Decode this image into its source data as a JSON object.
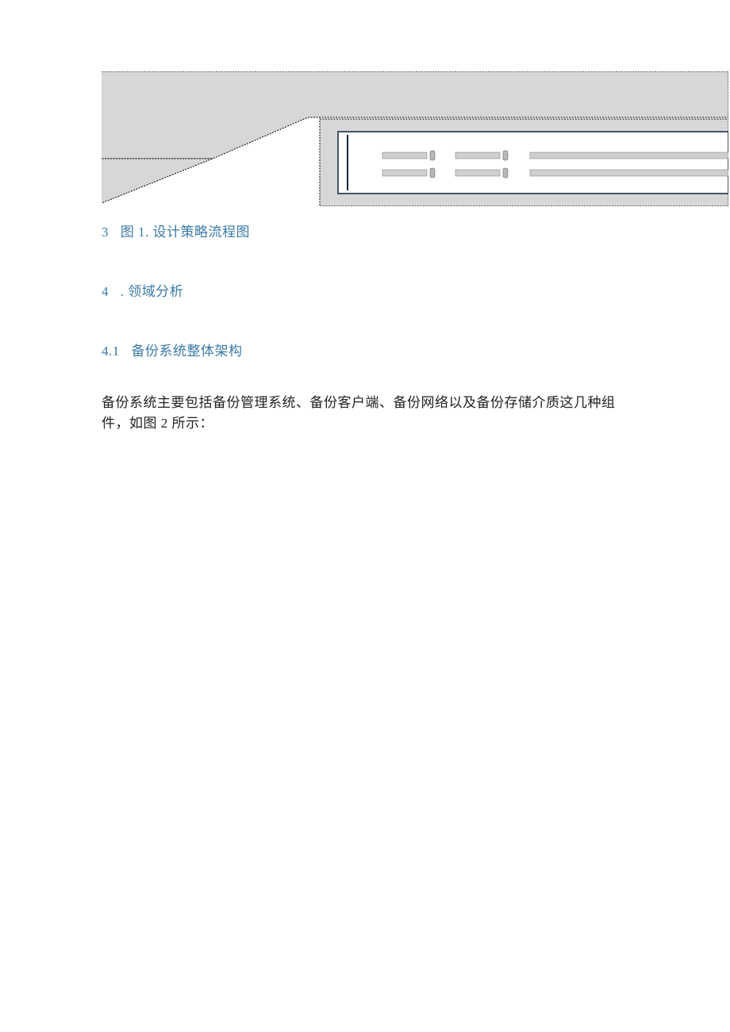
{
  "sections": {
    "caption": {
      "num": "3",
      "text": "图 1. 设计策略流程图"
    },
    "s4": {
      "num": "4",
      "text": ". 领域分析"
    },
    "s41": {
      "num": "4.1",
      "text": "备份系统整体架构"
    }
  },
  "paragraph": "备份系统主要包括备份管理系统、备份客户端、备份网络以及备份存储介质这几种组件，如图 2 所示："
}
